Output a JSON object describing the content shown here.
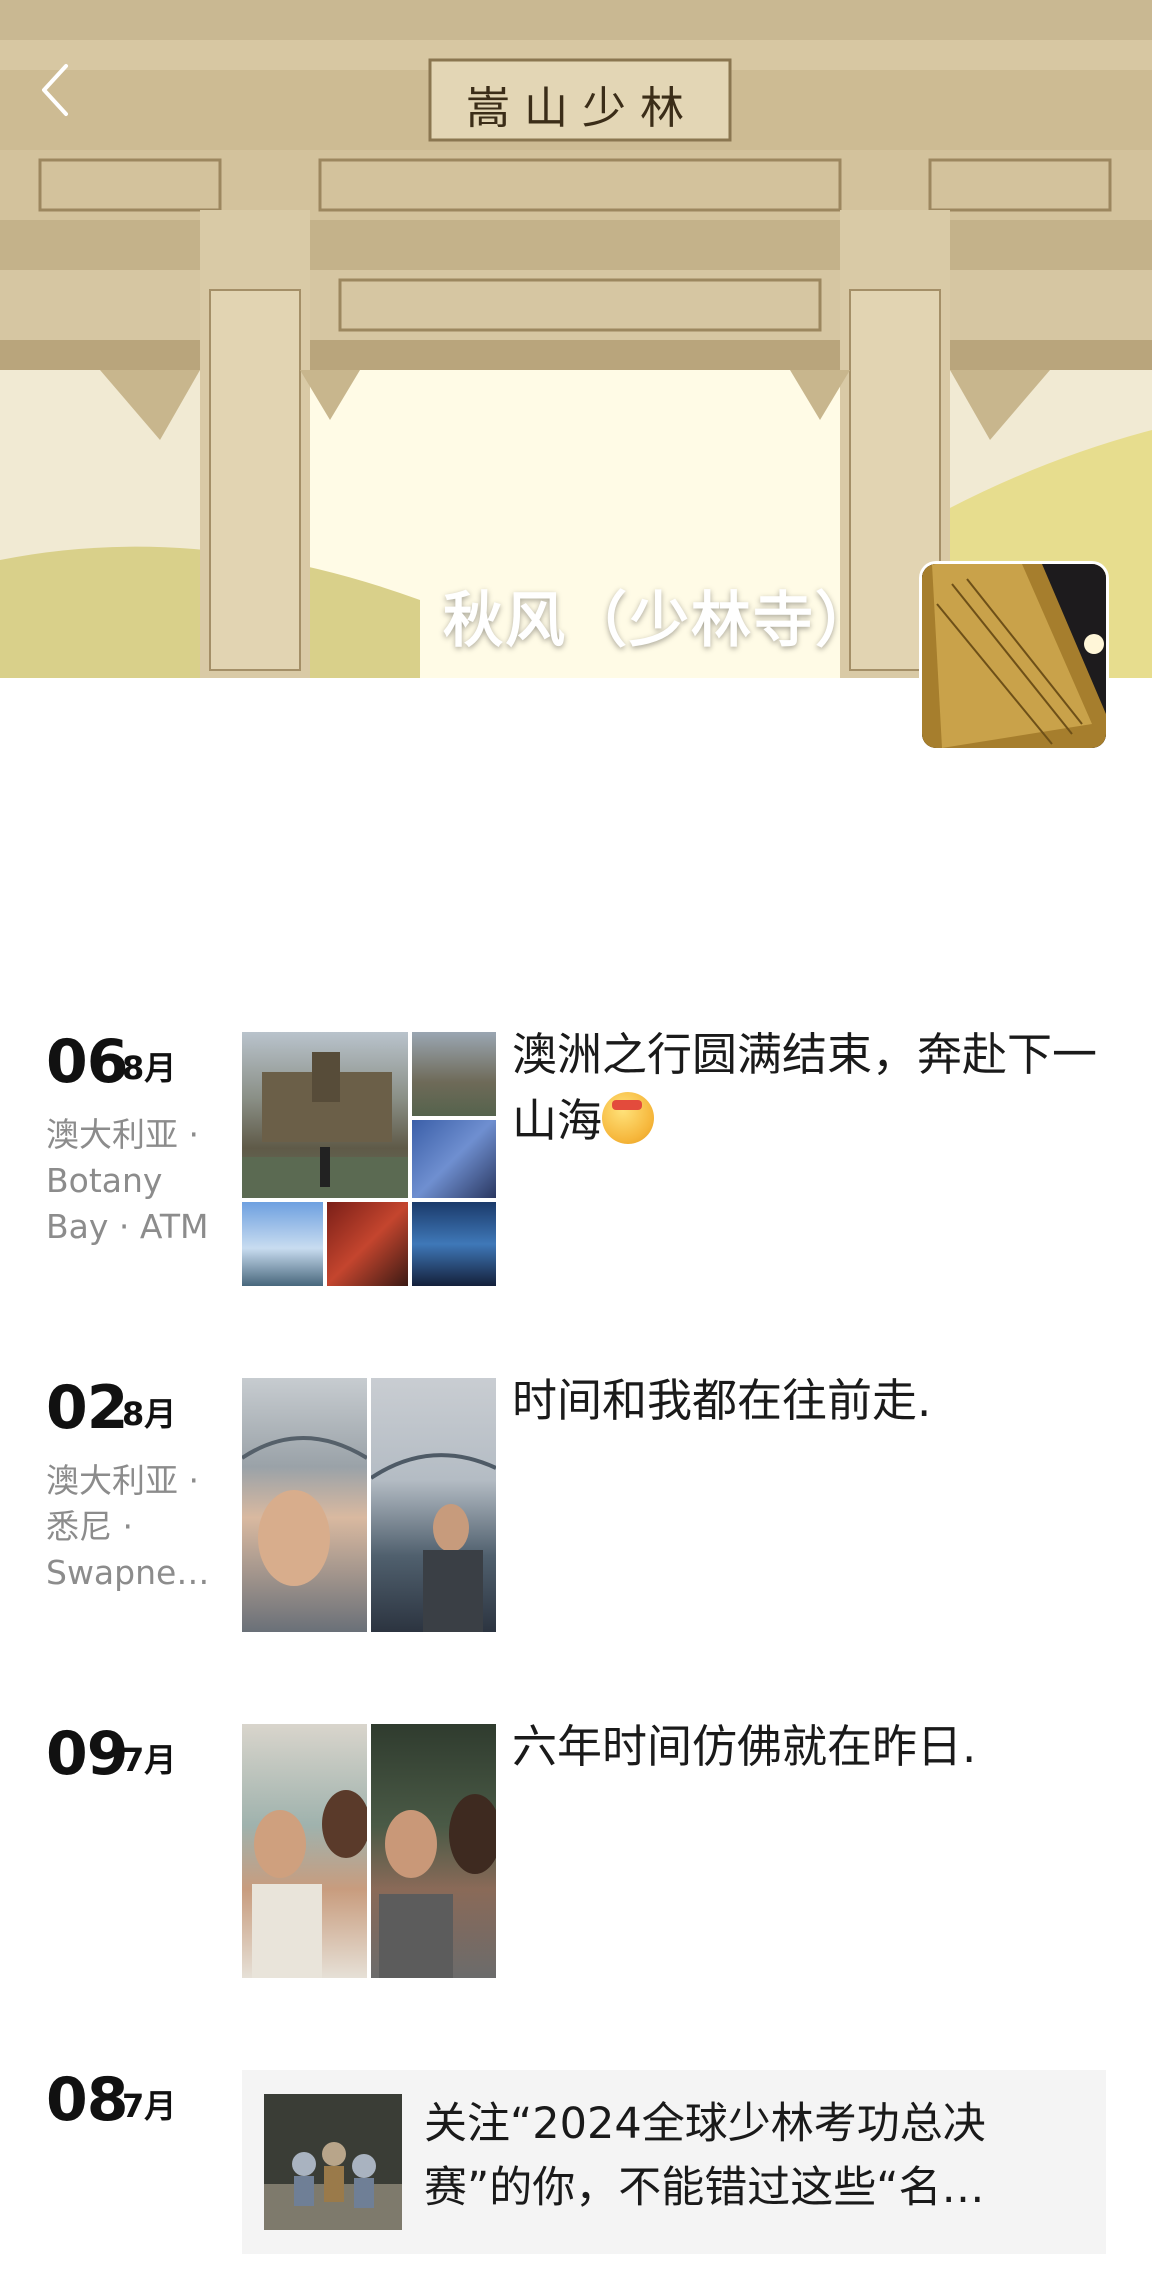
{
  "header": {
    "name": "秋风（少林寺）",
    "gate_plaque": "嵩山少林",
    "back_icon": "chevron-left-icon"
  },
  "posts": [
    {
      "day": "06",
      "month": "8月",
      "location": "澳大利亚 · Botany Bay · ATM",
      "text": "澳洲之行圆满结束，奔赴下一山海",
      "photo_count": 6
    },
    {
      "day": "02",
      "month": "8月",
      "location": "澳大利亚 · 悉尼 · Swapne…",
      "text": "时间和我都在往前走.",
      "photo_count": 2
    },
    {
      "day": "09",
      "month": "7月",
      "location": "",
      "text": "六年时间仿佛就在昨日.",
      "photo_count": 2
    },
    {
      "day": "08",
      "month": "7月",
      "location": "",
      "share_title": "关注“2024全球少林考功总决赛”的你，不能错过这些“名…"
    }
  ]
}
